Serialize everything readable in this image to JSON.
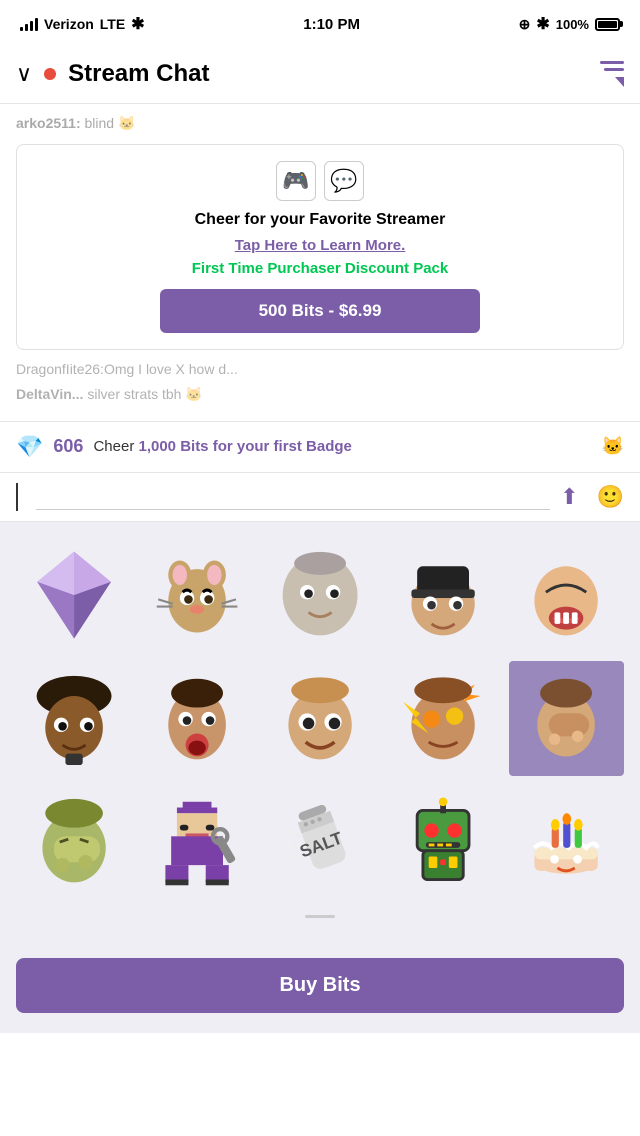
{
  "statusBar": {
    "carrier": "Verizon",
    "network": "LTE",
    "time": "1:10 PM",
    "battery": "100%"
  },
  "header": {
    "title": "Stream Chat",
    "liveIndicator": "live"
  },
  "chat": {
    "messages": [
      {
        "username": "arko2511",
        "text": "blind"
      },
      {
        "username": "",
        "text": "DragonfIite26:Omg I love X how do..."
      },
      {
        "username": "DeltaVin...",
        "text": "silver strats tbh"
      }
    ]
  },
  "promo": {
    "title": "Cheer for your Favorite Streamer",
    "link": "Tap Here to Learn More.",
    "discount": "First Time Purchaser Discount Pack",
    "button": "500 Bits - $6.99"
  },
  "bitsBanner": {
    "count": "606",
    "text": "Cheer ",
    "highlight": "1,000 Bits",
    "textAfter": " for your first Badge"
  },
  "chatInput": {
    "placeholder": ""
  },
  "emotes": {
    "rows": [
      [
        "bits-diamond",
        "pepe-cat",
        "face1",
        "face2",
        "face3"
      ],
      [
        "face4",
        "face5",
        "face6",
        "face7",
        "face8"
      ],
      [
        "face9",
        "anime-girl",
        "salt",
        "robot",
        "cake"
      ]
    ]
  },
  "buyBits": {
    "label": "Buy Bits"
  }
}
